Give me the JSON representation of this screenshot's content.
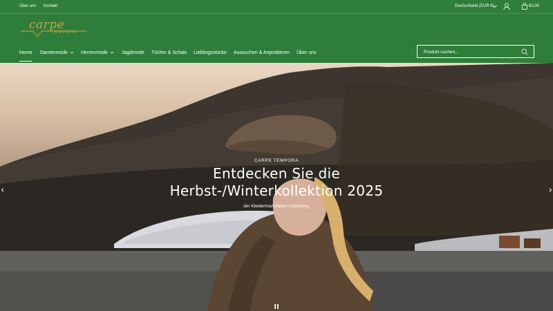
{
  "topbar": {
    "links": [
      "Über uns",
      "Kontakt"
    ],
    "country": "Deutschland (EUR €)",
    "cart_total": "€0,00"
  },
  "logo": {
    "script": "carpe",
    "sub": "TEMPORA"
  },
  "nav": {
    "items": [
      {
        "label": "Home",
        "active": true,
        "dropdown": false
      },
      {
        "label": "Damenmode",
        "active": false,
        "dropdown": true
      },
      {
        "label": "Herrenmode",
        "active": false,
        "dropdown": true
      },
      {
        "label": "Jagdmode",
        "active": false,
        "dropdown": false
      },
      {
        "label": "Tücher & Schals",
        "active": false,
        "dropdown": false
      },
      {
        "label": "Lieblingsstücke",
        "active": false,
        "dropdown": false
      },
      {
        "label": "Aussuchen & Anprobieren",
        "active": false,
        "dropdown": false
      },
      {
        "label": "Über uns",
        "active": false,
        "dropdown": false
      }
    ]
  },
  "search": {
    "placeholder": "Produkt suchen..."
  },
  "hero": {
    "eyebrow": "CARPE TEMPORA",
    "title_line1": "Entdecken Sie die",
    "title_line2": "Herbst-/Winterkollektion 2025",
    "subtitle": "der Kleidermanufaktur Habsburg."
  },
  "colors": {
    "brand_green": "#2e7d3a",
    "gold": "#c9a44b",
    "text": "#ffffff"
  },
  "icons": [
    "chevron-down-icon",
    "user-icon",
    "cart-icon",
    "search-icon",
    "arrow-left-icon",
    "arrow-right-icon",
    "pause-icon"
  ]
}
